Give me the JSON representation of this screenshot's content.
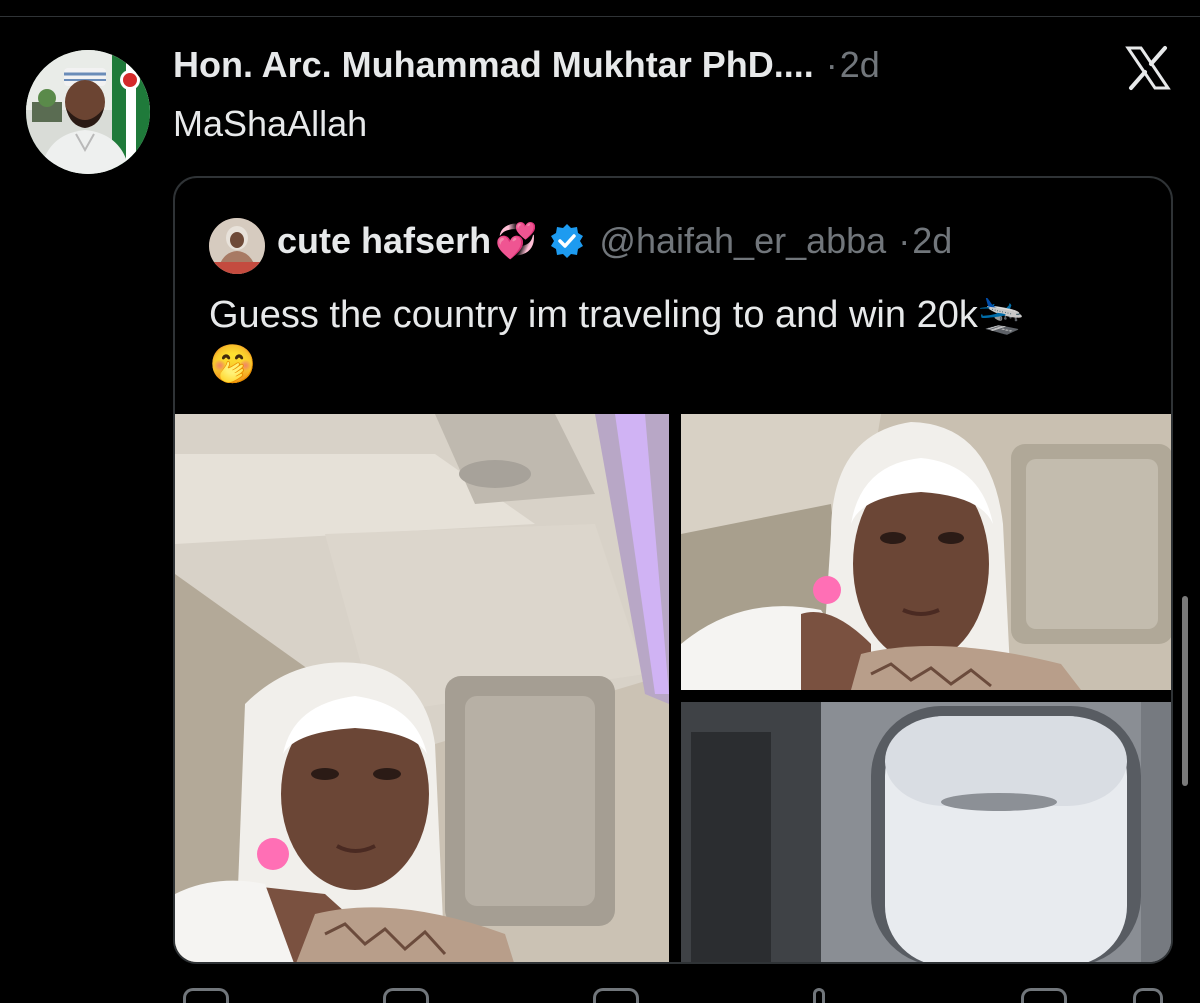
{
  "tweet": {
    "author": "Hon. Arc. Muhammad Mukhtar PhD....",
    "separator": "·",
    "time": "2d",
    "text": "MaShaAllah",
    "avatar_icon": "profile-avatar"
  },
  "quote": {
    "name": "cute hafserh",
    "name_emoji": "💞",
    "handle": "@haifah_er_abba",
    "separator": "·",
    "time": "2d",
    "text": "Guess the country im traveling to and win 20k🛬",
    "text_emoji": "🤭",
    "verified_icon": "verified-badge-icon",
    "verified_color": "#1d9bf0"
  },
  "images": [
    {
      "name": "selfie-seat-photo"
    },
    {
      "name": "selfie-closeup-photo"
    },
    {
      "name": "airplane-window-photo"
    }
  ],
  "colors": {
    "background": "#000000",
    "text": "#e7e9ea",
    "muted": "#71767b",
    "border": "#2f3336"
  }
}
